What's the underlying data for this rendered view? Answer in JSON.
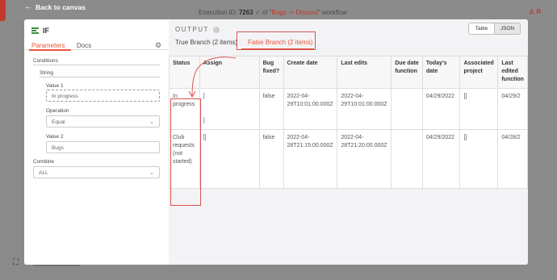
{
  "top": {
    "back_label": "Back to canvas",
    "exec_prefix": "Execution ID: ",
    "exec_id": "7263",
    "exec_of": " of \"",
    "workflow_name": "Bugs -> Discord",
    "exec_suffix": "\" workflow",
    "warn_text": "R"
  },
  "node": {
    "title": "IF"
  },
  "tabs": [
    "Parameters",
    "Docs"
  ],
  "params": {
    "conditions_label": "Conditions",
    "string_label": "String",
    "value1_label": "Value 1",
    "value1": "In progress",
    "operation_label": "Operation",
    "operation": "Equal",
    "value2_label": "Value 2",
    "value2": "Bugs",
    "combine_label": "Combine",
    "combine": "ALL"
  },
  "output": {
    "label": "OUTPUT",
    "true_branch": "True Branch (2 items)",
    "false_branch": "False Branch (2 items)",
    "view_table": "Table",
    "view_json": "JSON"
  },
  "table": {
    "headers": [
      "Status",
      "Assign",
      "Bug fixed?",
      "Create date",
      "Last edits",
      "Due date function",
      "Today's date",
      "Associated project",
      "Last edited function"
    ],
    "rows": [
      [
        "In progress",
        "[",
        "false",
        "2022-04-29T10:01:00.000Z",
        "2022-04-29T10:01:00.000Z",
        "",
        "04/29/2022",
        "[]",
        "04/29/2"
      ],
      [
        "Club requests (not started)",
        "[]",
        "false",
        "2022-04-28T21:15:00.000Z",
        "2022-04-28T21:20:00.000Z",
        "",
        "04/29/2022",
        "[]",
        "04/28/2"
      ]
    ],
    "row1_assign_close": "]"
  },
  "colors": {
    "accent": "#e8553b",
    "highlight": "#d9534f",
    "if_green": "#3e8e41"
  }
}
